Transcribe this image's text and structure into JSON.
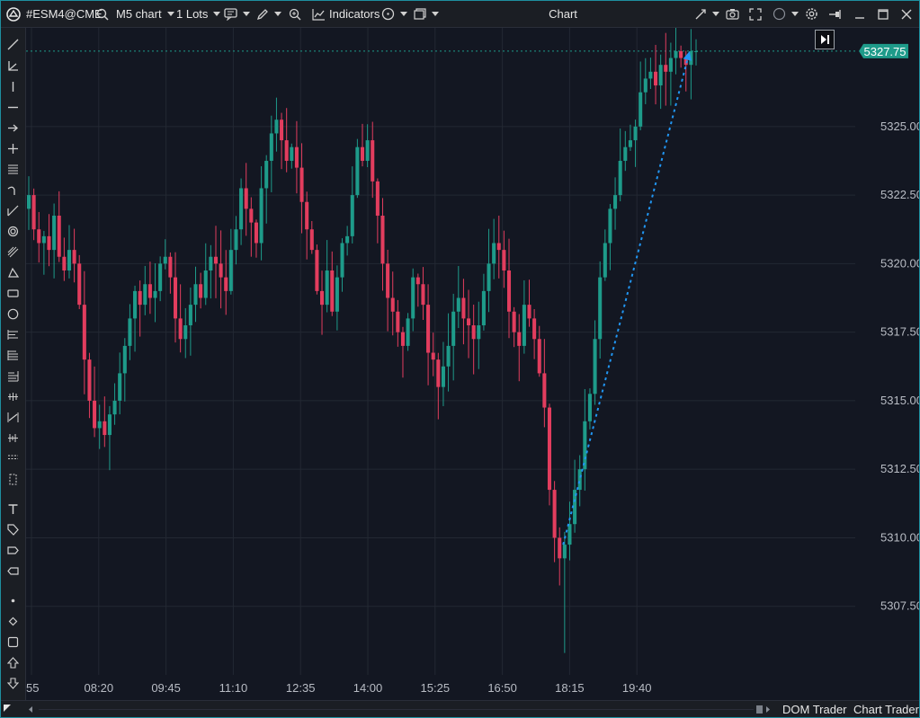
{
  "toolbar": {
    "symbol": "#ESM4@CME",
    "chart_type": "M5 chart",
    "lots": "1 Lots",
    "indicators": "Indicators",
    "window_title": "Chart"
  },
  "bottom": {
    "dom_trader": "DOM Trader",
    "chart_trader": "Chart Trader"
  },
  "chart_data": {
    "type": "candlestick",
    "symbol": "#ESM4@CME",
    "timeframe": "M5",
    "current_price_label": "5327.75",
    "current_price": 5327.75,
    "y_ticks": [
      "5307.50",
      "5310.00",
      "5312.50",
      "5315.00",
      "5317.50",
      "5320.00",
      "5322.50",
      "5325.00"
    ],
    "y_tick_values": [
      5307.5,
      5310.0,
      5312.5,
      5315.0,
      5317.5,
      5320.0,
      5322.5,
      5325.0
    ],
    "y_range": [
      5305.0,
      5328.6
    ],
    "x_ticks": [
      "55",
      "08:20",
      "09:45",
      "11:10",
      "12:35",
      "14:00",
      "15:25",
      "16:50",
      "18:15",
      "19:40"
    ],
    "grid": true,
    "closes": [
      5322.5,
      5321.25,
      5320.75,
      5321.0,
      5320.5,
      5321.75,
      5320.25,
      5319.75,
      5320.5,
      5320.0,
      5318.5,
      5316.5,
      5315.0,
      5314.0,
      5314.25,
      5313.75,
      5314.5,
      5315.0,
      5316.0,
      5317.0,
      5318.0,
      5319.0,
      5318.5,
      5319.25,
      5318.75,
      5319.0,
      5320.0,
      5320.25,
      5319.5,
      5318.0,
      5317.25,
      5317.75,
      5318.5,
      5319.25,
      5318.75,
      5319.75,
      5320.25,
      5320.0,
      5319.5,
      5319.0,
      5320.5,
      5321.25,
      5322.75,
      5322.0,
      5321.5,
      5320.75,
      5322.75,
      5323.75,
      5324.75,
      5325.25,
      5324.5,
      5323.75,
      5324.25,
      5323.5,
      5322.25,
      5321.25,
      5320.5,
      5319.0,
      5318.5,
      5319.75,
      5318.25,
      5319.5,
      5320.75,
      5321.0,
      5322.5,
      5324.25,
      5323.75,
      5324.5,
      5323.0,
      5321.75,
      5320.0,
      5318.75,
      5318.25,
      5317.5,
      5317.0,
      5318.0,
      5319.5,
      5319.25,
      5318.5,
      5316.75,
      5316.5,
      5315.5,
      5316.25,
      5317.0,
      5318.25,
      5318.75,
      5318.0,
      5317.75,
      5317.25,
      5317.75,
      5319.0,
      5320.0,
      5320.75,
      5320.5,
      5319.75,
      5318.25,
      5317.5,
      5317.0,
      5318.5,
      5318.0,
      5317.25,
      5316.0,
      5314.75,
      5311.75,
      5310.0,
      5309.25,
      5309.75,
      5310.5,
      5311.75,
      5312.5,
      5314.25,
      5315.25,
      5317.25,
      5319.5,
      5320.75,
      5322.0,
      5322.5,
      5323.75,
      5324.25,
      5324.5,
      5325.0,
      5326.25,
      5326.75,
      5327.0,
      5326.5,
      5327.25,
      5327.0,
      5327.5,
      5327.75,
      5327.5,
      5327.25,
      5327.75,
      5327.75
    ],
    "trendline": {
      "from_price": 5309.75,
      "to_price": 5327.75,
      "style": "dotted",
      "color": "#2196f3"
    }
  },
  "colors": {
    "bull": "#1e9b8a",
    "bear": "#e23d5e",
    "background": "#131722",
    "grid": "#232833",
    "price_badge": "#1e9b8a",
    "trendline": "#2196f3"
  },
  "icons": {
    "top": [
      "app-logo-icon",
      "search-icon",
      "chat-icon",
      "pencil-icon",
      "zoom-in-icon",
      "indicators-icon",
      "palette-icon",
      "template-icon",
      "collapse-icon",
      "camera-icon",
      "expand-icon",
      "circle-icon",
      "settings-icon",
      "pin-icon",
      "minimize-icon",
      "maximize-icon",
      "close-icon"
    ],
    "left": [
      "trendline-tool-icon",
      "angle-tool-icon",
      "vertical-line-icon",
      "horizontal-line-icon",
      "arrow-tool-icon",
      "crosshair-tool-icon",
      "fib-tool-icon",
      "curve-tool-icon",
      "pitchfork-tool-icon",
      "spiral-tool-icon",
      "channel-tool-icon",
      "triangle-tool-icon",
      "rectangle-tool-icon",
      "ellipse-tool-icon",
      "fib-retracement-icon",
      "fib-extension-icon",
      "fib-fan-icon",
      "gann-icon",
      "regression-icon",
      "volume-profile-icon",
      "measure-icon",
      "range-icon",
      "text-tool-icon",
      "tag-tool-icon",
      "label-tool-icon",
      "callout-tool-icon",
      "dot-icon",
      "diamond-icon",
      "square-icon",
      "up-arrow-icon",
      "down-arrow-icon"
    ]
  }
}
